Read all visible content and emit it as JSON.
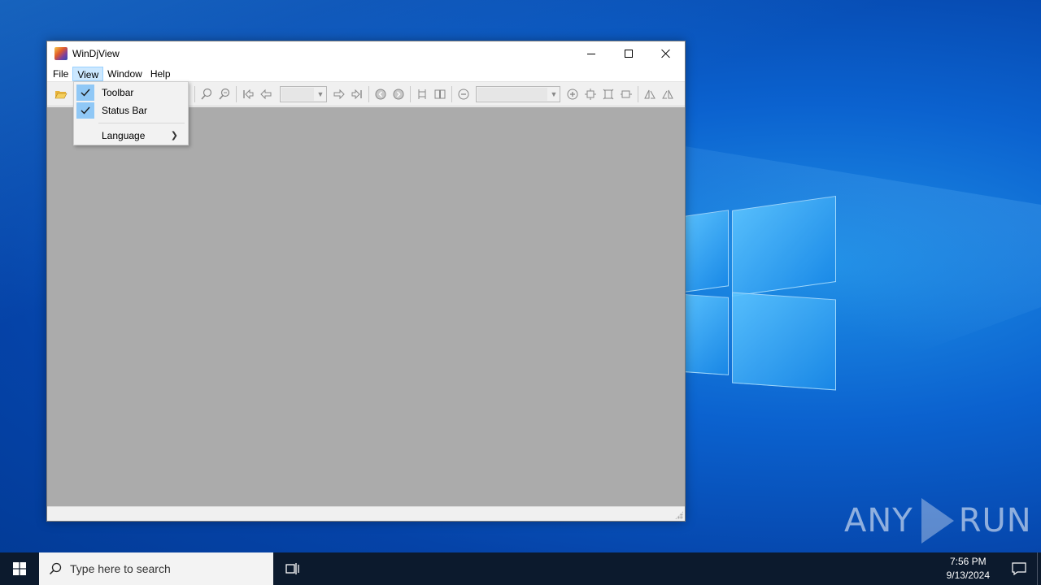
{
  "window": {
    "title": "WinDjView",
    "menus": [
      "File",
      "View",
      "Window",
      "Help"
    ],
    "active_menu": "View"
  },
  "view_menu": {
    "items": [
      {
        "label": "Toolbar",
        "checked": true
      },
      {
        "label": "Status Bar",
        "checked": true
      },
      {
        "label": "Language",
        "submenu": true
      }
    ]
  },
  "toolbar": {
    "page_combo_value": "",
    "zoom_combo_value": ""
  },
  "taskbar": {
    "search_placeholder": "Type here to search",
    "time": "7:56 PM",
    "date": "9/13/2024"
  },
  "watermark": {
    "left": "ANY",
    "right": "RUN"
  },
  "colors": {
    "desktop_blue": "#0b62cf",
    "client_gray": "#ababab",
    "menu_highlight": "#cce8ff",
    "check_highlight": "#90c8f6",
    "taskbar": "#0c1a2d"
  }
}
